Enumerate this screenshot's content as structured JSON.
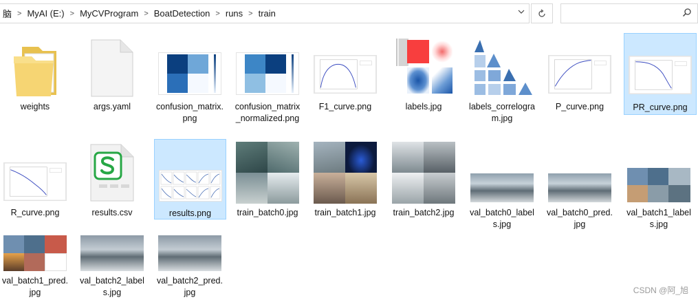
{
  "address_bar": {
    "crumbs": [
      "脑",
      "MyAI (E:)",
      "MyCVProgram",
      "BoatDetection",
      "runs",
      "train"
    ],
    "dropdown_icon": "chevron-down-icon"
  },
  "search": {
    "placeholder": "",
    "icon": "search-icon"
  },
  "files": [
    {
      "name": "weights",
      "type": "folder"
    },
    {
      "name": "args.yaml",
      "type": "blank-file"
    },
    {
      "name": "confusion_matrix.png",
      "type": "image"
    },
    {
      "name": "confusion_matrix_normalized.png",
      "type": "image"
    },
    {
      "name": "F1_curve.png",
      "type": "image"
    },
    {
      "name": "labels.jpg",
      "type": "image"
    },
    {
      "name": "labels_correlogram.jpg",
      "type": "image"
    },
    {
      "name": "P_curve.png",
      "type": "image"
    },
    {
      "name": "PR_curve.png",
      "type": "image",
      "selected": true
    },
    {
      "name": "R_curve.png",
      "type": "image"
    },
    {
      "name": "results.csv",
      "type": "csv"
    },
    {
      "name": "results.png",
      "type": "image",
      "selected": true
    },
    {
      "name": "train_batch0.jpg",
      "type": "image"
    },
    {
      "name": "train_batch1.jpg",
      "type": "image"
    },
    {
      "name": "train_batch2.jpg",
      "type": "image"
    },
    {
      "name": "val_batch0_labels.jpg",
      "type": "image"
    },
    {
      "name": "val_batch0_pred.jpg",
      "type": "image"
    },
    {
      "name": "val_batch1_labels.jpg",
      "type": "image"
    },
    {
      "name": "val_batch1_pred.jpg",
      "type": "image"
    },
    {
      "name": "val_batch2_labels.jpg",
      "type": "image"
    },
    {
      "name": "val_batch2_pred.jpg",
      "type": "image"
    }
  ],
  "watermark": "CSDN @阿_旭",
  "colors": {
    "selection": "#cce8ff",
    "selection_border": "#99d1ff",
    "accent_blue": "#1f5fa6"
  }
}
